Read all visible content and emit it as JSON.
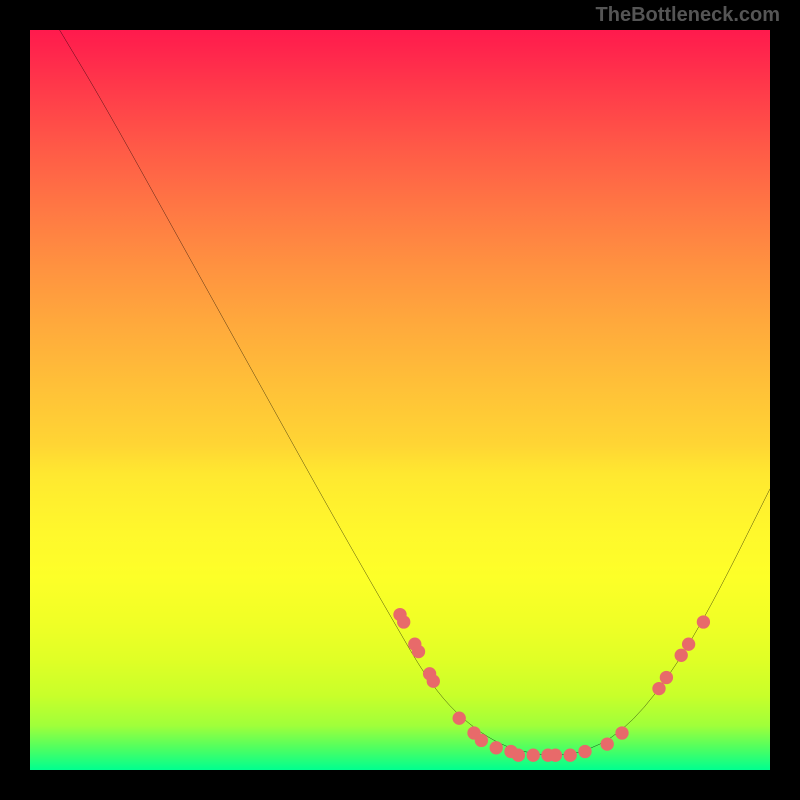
{
  "watermark": "TheBottleneck.com",
  "chart_data": {
    "type": "line",
    "title": "",
    "xlabel": "",
    "ylabel": "",
    "xlim": [
      0,
      100
    ],
    "ylim": [
      0,
      100
    ],
    "curve": [
      {
        "x": 4,
        "y": 100
      },
      {
        "x": 10,
        "y": 90
      },
      {
        "x": 20,
        "y": 72
      },
      {
        "x": 30,
        "y": 54
      },
      {
        "x": 40,
        "y": 36
      },
      {
        "x": 48,
        "y": 22
      },
      {
        "x": 55,
        "y": 10
      },
      {
        "x": 62,
        "y": 4
      },
      {
        "x": 68,
        "y": 2
      },
      {
        "x": 74,
        "y": 2
      },
      {
        "x": 80,
        "y": 5
      },
      {
        "x": 86,
        "y": 12
      },
      {
        "x": 92,
        "y": 22
      },
      {
        "x": 100,
        "y": 38
      }
    ],
    "markers": [
      {
        "x": 50,
        "y": 21
      },
      {
        "x": 50.5,
        "y": 20
      },
      {
        "x": 52,
        "y": 17
      },
      {
        "x": 52.5,
        "y": 16
      },
      {
        "x": 54,
        "y": 13
      },
      {
        "x": 54.5,
        "y": 12
      },
      {
        "x": 58,
        "y": 7
      },
      {
        "x": 60,
        "y": 5
      },
      {
        "x": 61,
        "y": 4
      },
      {
        "x": 63,
        "y": 3
      },
      {
        "x": 65,
        "y": 2.5
      },
      {
        "x": 66,
        "y": 2
      },
      {
        "x": 68,
        "y": 2
      },
      {
        "x": 70,
        "y": 2
      },
      {
        "x": 71,
        "y": 2
      },
      {
        "x": 73,
        "y": 2
      },
      {
        "x": 75,
        "y": 2.5
      },
      {
        "x": 78,
        "y": 3.5
      },
      {
        "x": 80,
        "y": 5
      },
      {
        "x": 85,
        "y": 11
      },
      {
        "x": 86,
        "y": 12.5
      },
      {
        "x": 88,
        "y": 15.5
      },
      {
        "x": 89,
        "y": 17
      },
      {
        "x": 91,
        "y": 20
      }
    ],
    "marker_color": "#e86a6a",
    "curve_color": "#000000"
  }
}
